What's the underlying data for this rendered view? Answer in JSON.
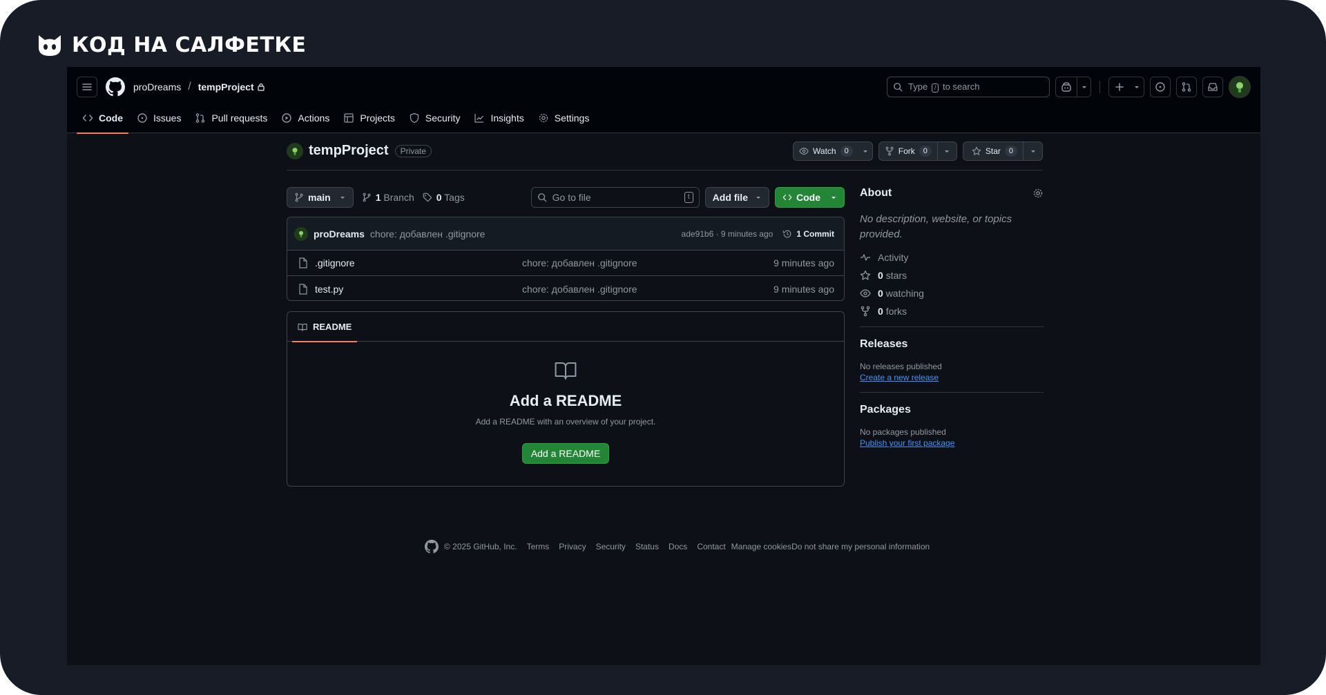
{
  "brand": {
    "text": "КОД НА САЛФЕТКЕ"
  },
  "header": {
    "owner": "proDreams",
    "separator": "/",
    "repo": "tempProject",
    "search_prefix": "Type",
    "search_key": "/",
    "search_suffix": "to search"
  },
  "tabs": [
    {
      "label": "Code",
      "icon": "code-icon"
    },
    {
      "label": "Issues",
      "icon": "issue-icon"
    },
    {
      "label": "Pull requests",
      "icon": "pull-request-icon"
    },
    {
      "label": "Actions",
      "icon": "play-icon"
    },
    {
      "label": "Projects",
      "icon": "table-icon"
    },
    {
      "label": "Security",
      "icon": "shield-icon"
    },
    {
      "label": "Insights",
      "icon": "graph-icon"
    },
    {
      "label": "Settings",
      "icon": "gear-icon"
    }
  ],
  "repo_head": {
    "name": "tempProject",
    "visibility": "Private",
    "watch_label": "Watch",
    "watch_count": "0",
    "fork_label": "Fork",
    "fork_count": "0",
    "star_label": "Star",
    "star_count": "0"
  },
  "toolbar": {
    "branch": "main",
    "branch_count": "1",
    "branch_label": "Branch",
    "tag_count": "0",
    "tag_label": "Tags",
    "goto_placeholder": "Go to file",
    "goto_key": "t",
    "add_file_label": "Add file",
    "code_label": "Code"
  },
  "latest_commit": {
    "author": "proDreams",
    "message": "chore: добавлен .gitignore",
    "meta": "ade91b6 · 9 minutes ago",
    "count_label": "1 Commit"
  },
  "files": [
    {
      "name": ".gitignore",
      "commit": "chore: добавлен .gitignore",
      "time": "9 minutes ago"
    },
    {
      "name": "test.py",
      "commit": "chore: добавлен .gitignore",
      "time": "9 minutes ago"
    }
  ],
  "readme": {
    "tab_label": "README",
    "title": "Add a README",
    "subtitle": "Add a README with an overview of your project.",
    "button": "Add a README"
  },
  "about": {
    "title": "About",
    "description": "No description, website, or topics provided.",
    "activity": "Activity",
    "stars_count": "0",
    "stars_label": "stars",
    "watching_count": "0",
    "watching_label": "watching",
    "forks_count": "0",
    "forks_label": "forks"
  },
  "releases": {
    "title": "Releases",
    "empty": "No releases published",
    "link": "Create a new release"
  },
  "packages": {
    "title": "Packages",
    "empty": "No packages published",
    "link": "Publish your first package"
  },
  "footer": {
    "copyright": "© 2025 GitHub, Inc.",
    "links": [
      "Terms",
      "Privacy",
      "Security",
      "Status",
      "Docs",
      "Contact",
      "Manage cookies",
      "Do not share my personal information"
    ]
  },
  "colors": {
    "frame_bg": "#181c27",
    "page_bg": "#0d1117",
    "header_bg": "#010409",
    "accent_tab": "#f78166",
    "green": "#238636",
    "link": "#4493f8"
  }
}
